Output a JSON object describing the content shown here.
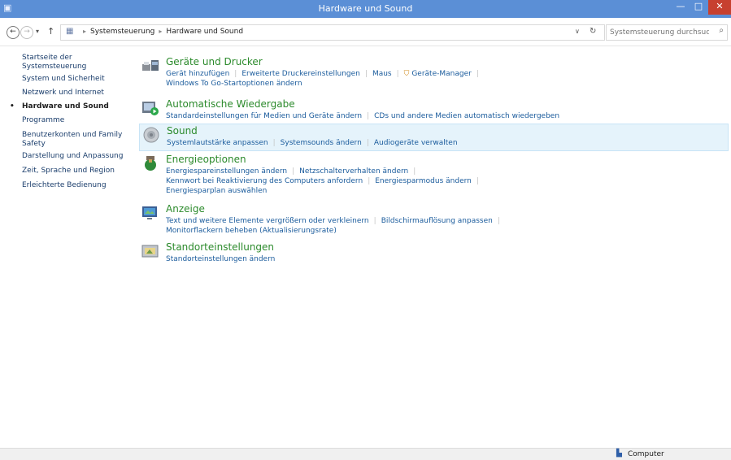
{
  "window": {
    "title": "Hardware und Sound",
    "min_glyph": "—",
    "max_glyph": "□",
    "close_glyph": "✕"
  },
  "nav": {
    "back_glyph": "←",
    "forward_glyph": "→",
    "recent_glyph": "▾",
    "up_glyph": "↑"
  },
  "address": {
    "crumbs": [
      "Systemsteuerung",
      "Hardware und Sound"
    ],
    "separator": "▸"
  },
  "search": {
    "placeholder": "Systemsteuerung durchsuchen"
  },
  "sidebar": {
    "items": [
      {
        "label": "Startseite der Systemsteuerung",
        "active": false
      },
      {
        "label": "System und Sicherheit",
        "active": false
      },
      {
        "label": "Netzwerk und Internet",
        "active": false
      },
      {
        "label": "Hardware und Sound",
        "active": true
      },
      {
        "label": "Programme",
        "active": false
      },
      {
        "label": "Benutzerkonten und Family Safety",
        "active": false
      },
      {
        "label": "Darstellung und Anpassung",
        "active": false
      },
      {
        "label": "Zeit, Sprache und Region",
        "active": false
      },
      {
        "label": "Erleichterte Bedienung",
        "active": false
      }
    ]
  },
  "categories": [
    {
      "title": "Geräte und Drucker",
      "highlighted": false,
      "links": [
        "Gerät hinzufügen",
        "Erweiterte Druckereinstellungen",
        "Maus",
        "Geräte-Manager",
        "Windows To Go-Startoptionen ändern"
      ]
    },
    {
      "title": "Automatische Wiedergabe",
      "highlighted": false,
      "links": [
        "Standardeinstellungen für Medien und Geräte ändern",
        "CDs und andere Medien automatisch wiedergeben"
      ]
    },
    {
      "title": "Sound",
      "highlighted": true,
      "links": [
        "Systemlautstärke anpassen",
        "Systemsounds ändern",
        "Audiogeräte verwalten"
      ]
    },
    {
      "title": "Energieoptionen",
      "highlighted": false,
      "links": [
        "Energiespareinstellungen ändern",
        "Netzschalterverhalten ändern",
        "Kennwort bei Reaktivierung des Computers anfordern",
        "Energiesparmodus ändern",
        "Energiesparplan auswählen"
      ]
    },
    {
      "title": "Anzeige",
      "highlighted": false,
      "links": [
        "Text und weitere Elemente vergrößern oder verkleinern",
        "Bildschirmauflösung anpassen",
        "Monitorflackern beheben (Aktualisierungsrate)"
      ]
    },
    {
      "title": "Standorteinstellungen",
      "highlighted": false,
      "links": [
        "Standorteinstellungen ändern"
      ]
    }
  ],
  "status": {
    "text": "Computer"
  },
  "colors": {
    "titlebar": "#5b8fd6",
    "category_title": "#2b8a2b",
    "link": "#1a5b9c",
    "highlight": "#e5f3fb"
  }
}
